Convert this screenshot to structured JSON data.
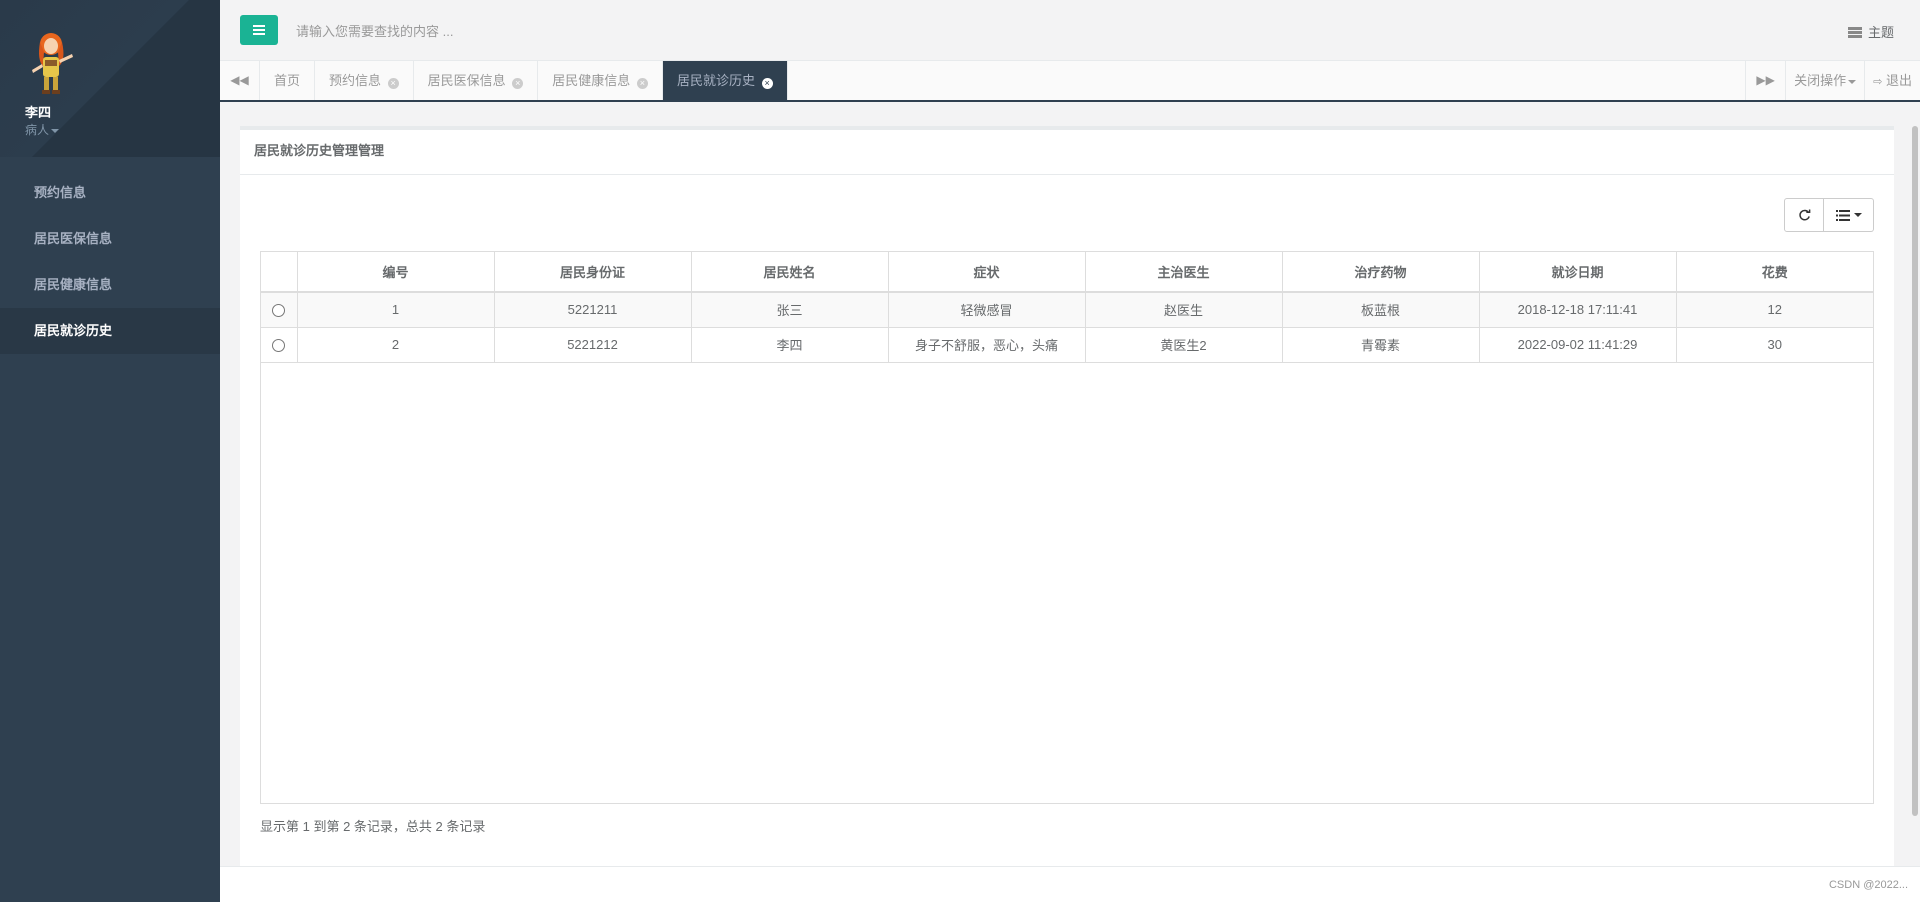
{
  "sidebar": {
    "user_name": "李四",
    "user_role": "病人",
    "items": [
      {
        "label": "预约信息"
      },
      {
        "label": "居民医保信息"
      },
      {
        "label": "居民健康信息"
      },
      {
        "label": "居民就诊历史"
      }
    ]
  },
  "topbar": {
    "search_placeholder": "请输入您需要查找的内容 ...",
    "theme_label": "主题"
  },
  "tabs": {
    "items": [
      {
        "label": "首页"
      },
      {
        "label": "预约信息"
      },
      {
        "label": "居民医保信息"
      },
      {
        "label": "居民健康信息"
      },
      {
        "label": "居民就诊历史"
      }
    ],
    "close_ops_label": "关闭操作",
    "logout_label": "退出"
  },
  "panel": {
    "title": "居民就诊历史管理管理"
  },
  "table": {
    "columns": [
      "编号",
      "居民身份证",
      "居民姓名",
      "症状",
      "主治医生",
      "治疗药物",
      "就诊日期",
      "花费"
    ],
    "rows": [
      [
        "1",
        "5221211",
        "张三",
        "轻微感冒",
        "赵医生",
        "板蓝根",
        "2018-12-18 17:11:41",
        "12"
      ],
      [
        "2",
        "5221212",
        "李四",
        "身子不舒服，恶心，头痛",
        "黄医生2",
        "青霉素",
        "2022-09-02 11:41:29",
        "30"
      ]
    ]
  },
  "pagination": {
    "info": "显示第 1 到第 2 条记录，总共 2 条记录"
  },
  "watermark": "CSDN @2022..."
}
